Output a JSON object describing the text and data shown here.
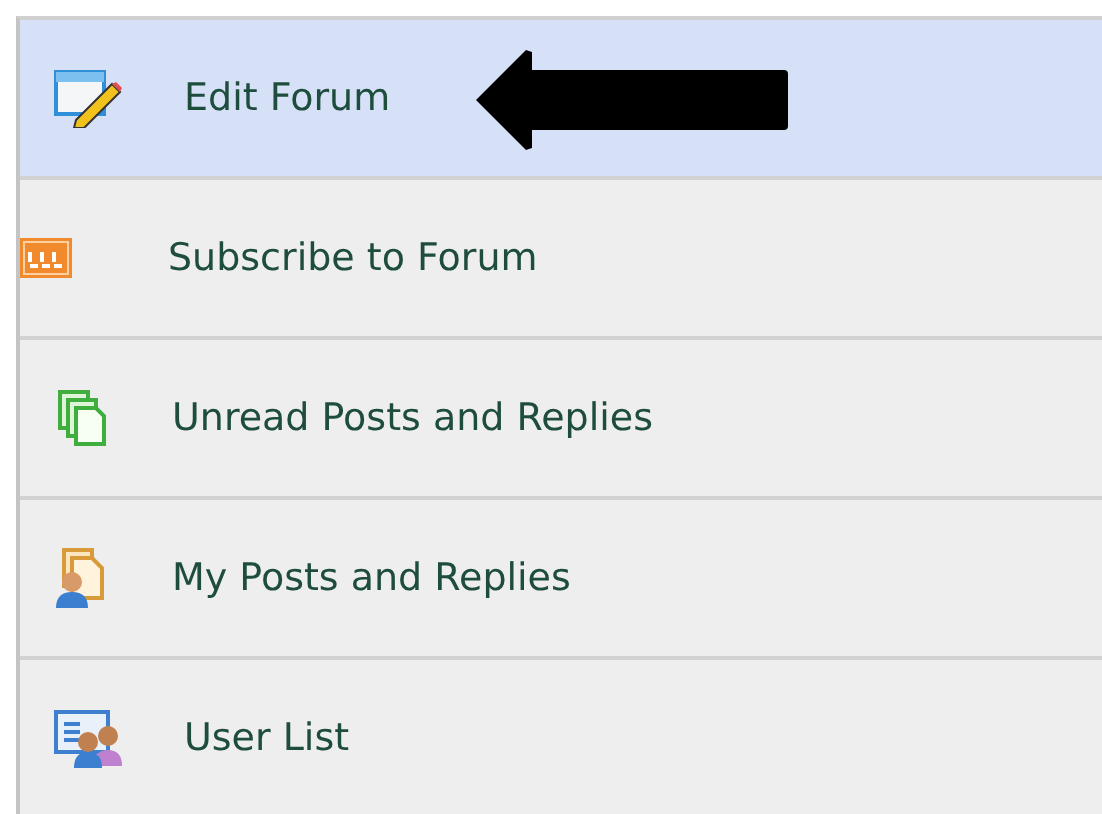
{
  "menu": {
    "items": [
      {
        "label": "Edit Forum",
        "kind": "edit",
        "selected": true
      },
      {
        "label": "Subscribe to Forum",
        "kind": "rss",
        "selected": false
      },
      {
        "label": "Unread Posts and Replies",
        "kind": "unread",
        "selected": false
      },
      {
        "label": "My Posts and Replies",
        "kind": "mine",
        "selected": false
      },
      {
        "label": "User List",
        "kind": "users",
        "selected": false
      }
    ]
  }
}
